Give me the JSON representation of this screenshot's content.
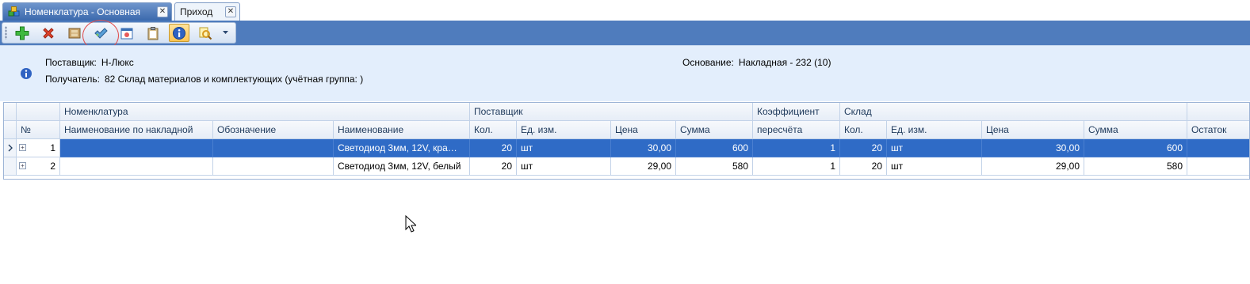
{
  "tabs": [
    {
      "label": "Номенклатура - Основная",
      "active": true
    },
    {
      "label": "Приход",
      "active": false
    }
  ],
  "toolbar": {
    "buttons": [
      {
        "icon": "add-icon"
      },
      {
        "icon": "delete-icon"
      },
      {
        "icon": "film-icon"
      },
      {
        "icon": "checkmark-icon"
      },
      {
        "icon": "calendar-icon"
      },
      {
        "icon": "clipboard-icon"
      },
      {
        "icon": "info-icon",
        "active": true
      },
      {
        "icon": "search-icon"
      }
    ]
  },
  "info": {
    "supplier_label": "Поставщик:",
    "supplier_value": "Н-Люкс",
    "receiver_label": "Получатель:",
    "receiver_value": "82 Склад материалов и комплектующих (учётная группа: )",
    "basis_label": "Основание:",
    "basis_value": "Накладная - 232 (10)"
  },
  "grid": {
    "bands": {
      "nomenclature": "Номенклатура",
      "supplier": "Поставщик",
      "coefficient": "Коэффициент",
      "warehouse": "Склад"
    },
    "columns": {
      "no": "№",
      "invoice_name": "Наименование по накладной",
      "designation": "Обозначение",
      "name": "Наименование",
      "sup_qty": "Кол.",
      "sup_unit": "Ед. изм.",
      "sup_price": "Цена",
      "sup_sum": "Сумма",
      "recalc": "пересчёта",
      "wh_qty": "Кол.",
      "wh_unit": "Ед. изм.",
      "wh_price": "Цена",
      "wh_sum": "Сумма",
      "balance": "Остаток"
    },
    "rows": [
      {
        "no": "1",
        "invoice_name": "",
        "designation": "",
        "name": "Светодиод 3мм, 12V, кра…",
        "sup_qty": "20",
        "sup_unit": "шт",
        "sup_price": "30,00",
        "sup_sum": "600",
        "recalc": "1",
        "wh_qty": "20",
        "wh_unit": "шт",
        "wh_price": "30,00",
        "wh_sum": "600",
        "balance": ""
      },
      {
        "no": "2",
        "invoice_name": "",
        "designation": "",
        "name": "Светодиод 3мм, 12V, белый",
        "sup_qty": "20",
        "sup_unit": "шт",
        "sup_price": "29,00",
        "sup_sum": "580",
        "recalc": "1",
        "wh_qty": "20",
        "wh_unit": "шт",
        "wh_price": "29,00",
        "wh_sum": "580",
        "balance": ""
      }
    ]
  }
}
